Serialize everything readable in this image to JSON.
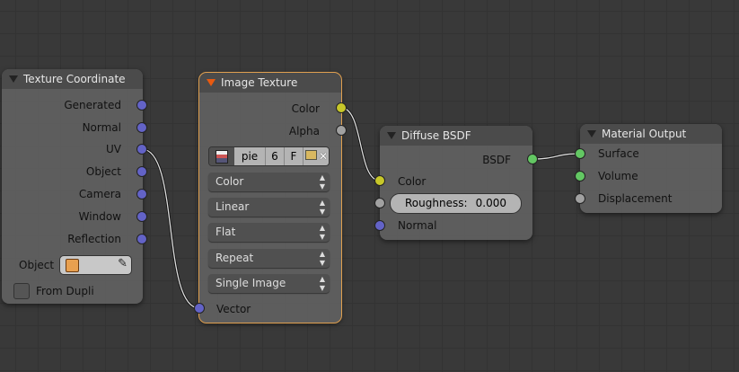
{
  "nodes": {
    "tex_coord": {
      "title": "Texture Coordinate",
      "outputs": [
        "Generated",
        "Normal",
        "UV",
        "Object",
        "Camera",
        "Window",
        "Reflection"
      ],
      "object_label": "Object",
      "object_value": "",
      "from_dupli_label": "From Dupli",
      "from_dupli_checked": false
    },
    "image_texture": {
      "title": "Image Texture",
      "outputs": [
        "Color",
        "Alpha"
      ],
      "image_name": "pie",
      "users": "6",
      "fake": "F",
      "dropdowns": [
        "Color",
        "Linear",
        "Flat",
        "Repeat",
        "Single Image"
      ],
      "input": "Vector"
    },
    "diffuse": {
      "title": "Diffuse BSDF",
      "output": "BSDF",
      "inputs": [
        "Color",
        "Normal"
      ],
      "roughness_label": "Roughness:",
      "roughness_value": "0.000"
    },
    "output": {
      "title": "Material Output",
      "inputs": [
        "Surface",
        "Volume",
        "Displacement"
      ]
    }
  },
  "colors": {
    "vector_socket": "#6363c7",
    "color_socket": "#c7c729",
    "float_socket": "#a1a1a1",
    "shader_socket": "#63c763",
    "active_outline": "#e0a050"
  }
}
